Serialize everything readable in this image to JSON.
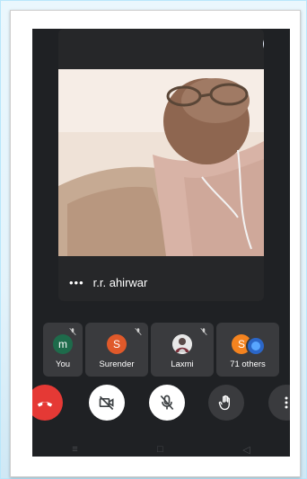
{
  "main_tile": {
    "participant_name": "r.r. ahirwar",
    "more_icon": "more-horiz-icon",
    "pin_icon": "pin-icon"
  },
  "participants": [
    {
      "name": "You",
      "initial": "m",
      "color": "#1e6b4b",
      "muted": true
    },
    {
      "name": "Surender",
      "initial": "S",
      "color": "#e0592a",
      "muted": true
    },
    {
      "name": "Laxmi",
      "initial": "",
      "color": "#d9d9d9",
      "muted": true
    },
    {
      "name": "71 others",
      "initial": "S",
      "color": "#f4831f",
      "muted": false
    }
  ],
  "controls": {
    "end_call": "end-call-icon",
    "camera": "camera-off-icon",
    "mic": "mic-off-icon",
    "raise_hand": "raise-hand-icon",
    "more": "more-vert-icon",
    "accent_red": "#e53935"
  },
  "navbar": [
    "≡",
    "□",
    "◁"
  ]
}
